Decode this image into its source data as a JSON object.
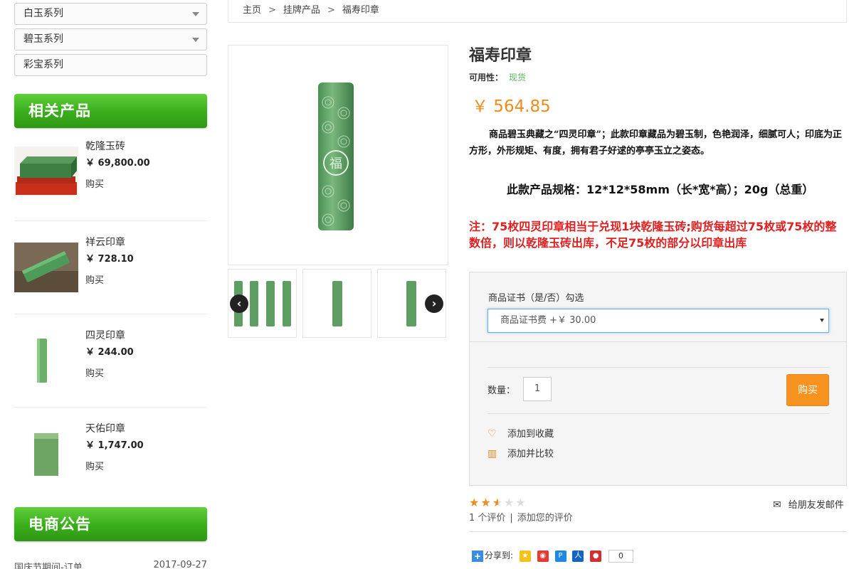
{
  "sidebar": {
    "categories": [
      {
        "label": "白玉系列",
        "has_dropdown": true
      },
      {
        "label": "碧玉系列",
        "has_dropdown": true
      },
      {
        "label": "彩宝系列",
        "has_dropdown": false
      }
    ],
    "related_heading": "相关产品",
    "related": [
      {
        "name": "乾隆玉砖",
        "price": "￥ 69,800.00",
        "buy": "购买"
      },
      {
        "name": "祥云印章",
        "price": "￥ 728.10",
        "buy": "购买"
      },
      {
        "name": "四灵印章",
        "price": "￥ 244.00",
        "buy": "购买"
      },
      {
        "name": "天佑印章",
        "price": "￥ 1,747.00",
        "buy": "购买"
      }
    ],
    "notice_heading": "电商公告",
    "notice": {
      "title": "国庆节期间-订单....",
      "date": "2017-09-27"
    }
  },
  "breadcrumb": {
    "home": "主页",
    "category": "挂牌产品",
    "current": "福寿印章"
  },
  "product": {
    "title": "福寿印章",
    "availability_label": "可用性：",
    "availability_value": "现货",
    "price": "￥ 564.85",
    "description": "商品碧玉典藏之“四灵印章”；此款印章藏品为碧玉制，色艳润泽，细腻可人；印底为正方形，外形规矩、有度，拥有君子好逑的亭亭玉立之姿态。",
    "spec": "此款产品规格：12*12*58mm（长*宽*高）；20g（总重）",
    "note": "注：75枚四灵印章相当于兑现1块乾隆玉砖;购货每超过75枚或75枚的整数倍，则以乾隆玉砖出库，不足75枚的部分以印章出库"
  },
  "options": {
    "certificate_label": "商品证书（是/否）勾选",
    "certificate_value": "商品证书费 +￥ 30.00",
    "quantity_label": "数量：",
    "quantity_value": "1",
    "buy_label": "购买",
    "wishlist_label": "添加到收藏",
    "compare_label": "添加并比较"
  },
  "rating": {
    "stars": 2.5,
    "max": 5,
    "review_count": "1 个评价",
    "add_review": "添加您的评价",
    "mail_friend": "给朋友发邮件"
  },
  "share": {
    "label": "分享到:",
    "count": "0"
  },
  "colors": {
    "accent": "#f28a1c",
    "green": "#3aad1c",
    "red": "#e02020",
    "available": "#5cb85c"
  }
}
